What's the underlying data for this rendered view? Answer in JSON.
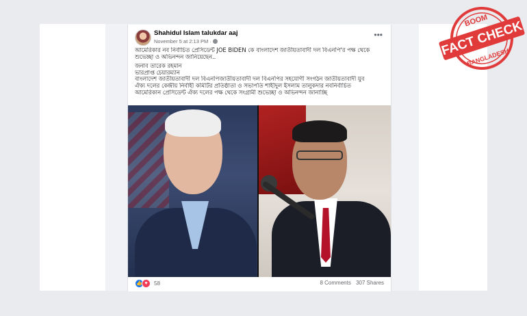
{
  "post": {
    "author": "Shahidul Islam talukdar aaj",
    "time": "November 5 at 2:13 PM ·",
    "text_lines": [
      "আমেরিকার নব নির্বাচিত প্রেসিডেন্ট JOE BIDEN কে বাংলাদেশ জাতীয়তাবাদী দল বিএনপি'র পক্ষ থেকে",
      "শুভেচ্ছা ও অভিনন্দন জানিয়েছেন..",
      "",
      "জনাব তারেক রহমান",
      "ভারপ্রাপ্ত চেয়ারম্যান",
      "বাংলাদেশ জাতীয়তাবাদী দল বিএনপিজাতীয়তাবাদী দল বিএনপির সহযোগী সংগঠন জাতীয়তাবাদী যুব",
      "ঐক্য দলের কেন্দ্রীয় নির্বাহী কমিটির প্রতিষ্ঠাতা ও সভাপতি শাহীদুল ইসলাম তালুকদার নবনির্বাচিত",
      "আমেরিকান প্রেসিডেন্ট ঐক্য দলের পক্ষ থেকে সংগ্রামী শুভেচ্ছা ও অভিনন্দন জানাচ্ছি"
    ],
    "reaction_count": "58",
    "comments": "8 Comments",
    "shares": "307 Shares"
  },
  "stamp": {
    "top": "BOOM",
    "middle": "FACT CHECK",
    "bottom": "BANGLADESH"
  },
  "colors": {
    "stamp_red": "#e03a3a",
    "facebook_blue": "#1877f2",
    "love_red": "#f33e58"
  }
}
